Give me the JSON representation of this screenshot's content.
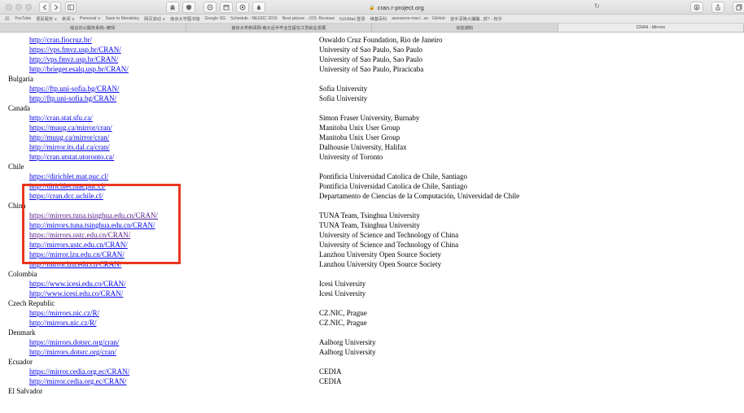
{
  "browser": {
    "address": "cran.r-project.org",
    "bookmarks": [
      "YouTube",
      "便民服务 ∨",
      "新闻 ∨",
      "Personal ∨",
      "Save to Mendeley",
      "网页滚动 ∨",
      "南京大学图书馆",
      "Google SG",
      "Schedule - NEUDC 2015",
      "Best picture ...015: Reviews",
      "NJUMail 登录",
      "维基百科",
      "awesome-mac/...ac · GitHub",
      "徒手深降大蹦蹦...部? - 知乎"
    ],
    "tabs": [
      {
        "label": "综合办公服务系统--教师",
        "active": false
      },
      {
        "label": "南京大学新闻网-南大近半毕业生留在江苏就业发展",
        "active": false
      },
      {
        "label": "动态通知",
        "active": false
      },
      {
        "label": "CRAN - Mirrors",
        "active": true
      }
    ]
  },
  "mirrors": [
    {
      "type": "mirror",
      "url": "http://cran.fiocruz.br/",
      "org": "Oswaldo Cruz Foundation, Rio de Janeiro"
    },
    {
      "type": "mirror",
      "url": "https://vps.fmvz.usp.br/CRAN/",
      "org": "University of Sao Paulo, Sao Paulo"
    },
    {
      "type": "mirror",
      "url": "http://vps.fmvz.usp.br/CRAN/",
      "org": "University of Sao Paulo, Sao Paulo"
    },
    {
      "type": "mirror",
      "url": "http://brieger.esalq.usp.br/CRAN/",
      "org": "University of Sao Paulo, Piracicaba"
    },
    {
      "type": "country",
      "name": "Bulgaria"
    },
    {
      "type": "mirror",
      "url": "https://ftp.uni-sofia.bg/CRAN/",
      "org": "Sofia University"
    },
    {
      "type": "mirror",
      "url": "http://ftp.uni-sofia.bg/CRAN/",
      "org": "Sofia University"
    },
    {
      "type": "country",
      "name": "Canada"
    },
    {
      "type": "mirror",
      "url": "http://cran.stat.sfu.ca/",
      "org": "Simon Fraser University, Burnaby"
    },
    {
      "type": "mirror",
      "url": "https://muug.ca/mirror/cran/",
      "org": "Manitoba Unix User Group"
    },
    {
      "type": "mirror",
      "url": "http://muug.ca/mirror/cran/",
      "org": "Manitoba Unix User Group"
    },
    {
      "type": "mirror",
      "url": "http://mirror.its.dal.ca/cran/",
      "org": "Dalhousie University, Halifax"
    },
    {
      "type": "mirror",
      "url": "http://cran.utstat.utoronto.ca/",
      "org": "University of Toronto"
    },
    {
      "type": "country",
      "name": "Chile"
    },
    {
      "type": "mirror",
      "url": "https://dirichlet.mat.puc.cl/",
      "org": "Pontificia Universidad Catolica de Chile, Santiago"
    },
    {
      "type": "mirror",
      "url": "http://dirichlet.mat.puc.cl/",
      "org": "Pontificia Universidad Catolica de Chile, Santiago"
    },
    {
      "type": "mirror",
      "url": "https://cran.dcc.uchile.cl/",
      "org": "Departamento de Ciencias de la Computación, Universidad de Chile"
    },
    {
      "type": "country",
      "name": "China"
    },
    {
      "type": "mirror",
      "url": "https://mirrors.tuna.tsinghua.edu.cn/CRAN/",
      "org": "TUNA Team, Tsinghua University",
      "visited": true
    },
    {
      "type": "mirror",
      "url": "http://mirrors.tuna.tsinghua.edu.cn/CRAN/",
      "org": "TUNA Team, Tsinghua University"
    },
    {
      "type": "mirror",
      "url": "https://mirrors.ustc.edu.cn/CRAN/",
      "org": "University of Science and Technology of China",
      "visited": true
    },
    {
      "type": "mirror",
      "url": "http://mirrors.ustc.edu.cn/CRAN/",
      "org": "University of Science and Technology of China"
    },
    {
      "type": "mirror",
      "url": "https://mirror.lzu.edu.cn/CRAN/",
      "org": "Lanzhou University Open Source Society"
    },
    {
      "type": "mirror",
      "url": "http://mirror.lzu.edu.cn/CRAN/",
      "org": "Lanzhou University Open Source Society"
    },
    {
      "type": "country",
      "name": "Colombia"
    },
    {
      "type": "mirror",
      "url": "https://www.icesi.edu.co/CRAN/",
      "org": "Icesi University"
    },
    {
      "type": "mirror",
      "url": "http://www.icesi.edu.co/CRAN/",
      "org": "Icesi University"
    },
    {
      "type": "country",
      "name": "Czech Republic"
    },
    {
      "type": "mirror",
      "url": "https://mirrors.nic.cz/R/",
      "org": "CZ.NIC, Prague"
    },
    {
      "type": "mirror",
      "url": "http://mirrors.nic.cz/R/",
      "org": "CZ.NIC, Prague"
    },
    {
      "type": "country",
      "name": "Denmark"
    },
    {
      "type": "mirror",
      "url": "https://mirrors.dotsrc.org/cran/",
      "org": "Aalborg University"
    },
    {
      "type": "mirror",
      "url": "http://mirrors.dotsrc.org/cran/",
      "org": "Aalborg University"
    },
    {
      "type": "country",
      "name": "Ecuador"
    },
    {
      "type": "mirror",
      "url": "https://mirror.cedia.org.ec/CRAN/",
      "org": "CEDIA"
    },
    {
      "type": "mirror",
      "url": "http://mirror.cedia.org.ec/CRAN/",
      "org": "CEDIA"
    },
    {
      "type": "country",
      "name": "El Salvador"
    }
  ],
  "colors": {
    "link": "#0000ee",
    "visited": "#551a8b",
    "highlight": "#e8371f"
  }
}
